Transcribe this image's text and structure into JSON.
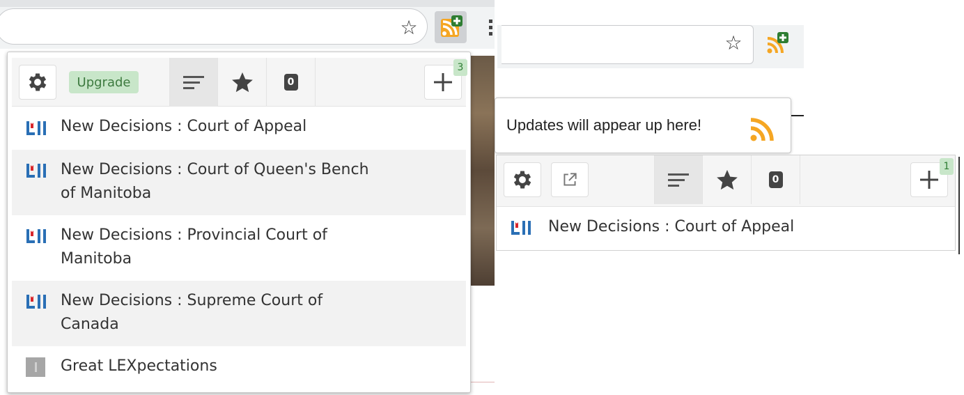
{
  "left_panel": {
    "upgrade_label": "Upgrade",
    "count_value": "0",
    "badge_count": "3",
    "feeds": [
      {
        "lines": [
          "New Decisions : Court of Appeal"
        ],
        "icon": "canlii-icon"
      },
      {
        "lines": [
          "New Decisions : Court of Queen's Bench",
          "of Manitoba"
        ],
        "icon": "canlii-icon"
      },
      {
        "lines": [
          "New Decisions : Provincial Court of",
          "Manitoba"
        ],
        "icon": "canlii-icon"
      },
      {
        "lines": [
          "New Decisions : Supreme Court of",
          "Canada"
        ],
        "icon": "canlii-icon"
      },
      {
        "lines": [
          "Great LEXpectations"
        ],
        "icon": "generic-feed-icon"
      }
    ]
  },
  "right_panel": {
    "tooltip_text": "Updates will appear up here!",
    "count_value": "0",
    "badge_count": "1",
    "feeds": [
      {
        "lines": [
          "New Decisions : Court of Appeal"
        ],
        "icon": "canlii-icon"
      }
    ]
  },
  "colors": {
    "rss_orange": "#f5a623",
    "badge_green": "#c8e6c9",
    "canlii_blue": "#2a6fb5",
    "canlii_red": "#d9262a"
  }
}
